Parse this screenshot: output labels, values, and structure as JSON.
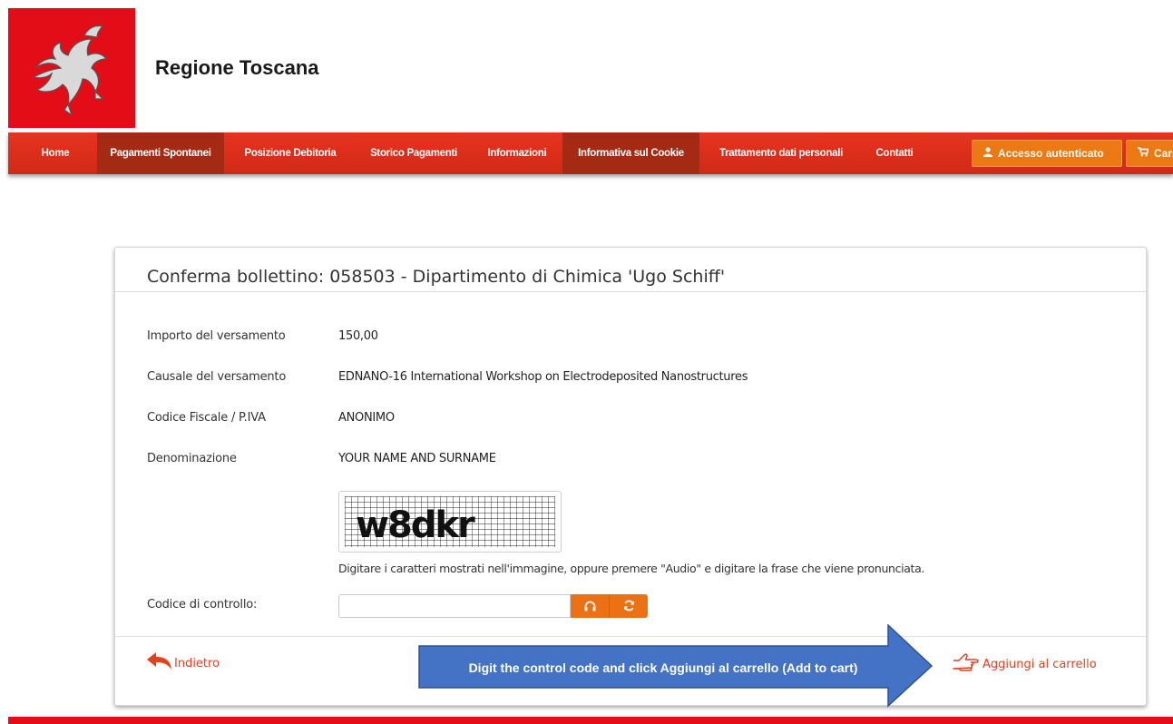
{
  "header": {
    "site_title": "Regione Toscana"
  },
  "nav": {
    "items": [
      {
        "label": "Home"
      },
      {
        "label": "Pagamenti Spontanei"
      },
      {
        "label": "Posizione Debitoria"
      },
      {
        "label": "Storico Pagamenti"
      },
      {
        "label": "Informazioni"
      },
      {
        "label": "Informativa sul Cookie"
      },
      {
        "label": "Trattamento dati personali"
      },
      {
        "label": "Contatti"
      }
    ],
    "login_label": "Accesso autenticato",
    "cart_label": "Carrello",
    "user_icon": "user-icon",
    "cart_icon": "cart-icon"
  },
  "panel": {
    "title": "Conferma bollettino: 058503 - Dipartimento di Chimica 'Ugo Schiff'",
    "fields": [
      {
        "label": "Importo del versamento",
        "value": "150,00"
      },
      {
        "label": "Causale del versamento",
        "value": "EDNANO-16 International Workshop on Electrodeposited Nanostructures"
      },
      {
        "label": "Codice Fiscale / P.IVA",
        "value": "ANONIMO"
      },
      {
        "label": "Denominazione",
        "value": "YOUR NAME AND SURNAME"
      }
    ],
    "captcha_text": "w8dkr",
    "captcha_hint": "Digitare i caratteri mostrati nell'immagine, oppure premere \"Audio\" e digitare la frase che viene pronunciata.",
    "control_code_label": "Codice di controllo:",
    "control_code_value": "",
    "back_label": "Indietro",
    "add_to_cart_label": "Aggiungi al carrello"
  },
  "callout": {
    "text": "Digit the control code and click Aggiungi al carrello (Add to cart)"
  },
  "colors": {
    "brand_red": "#e30d17",
    "nav_red": "#e8331f",
    "nav_active": "#a52a14",
    "orange": "#ec7014",
    "callout_blue": "#4472c4"
  }
}
